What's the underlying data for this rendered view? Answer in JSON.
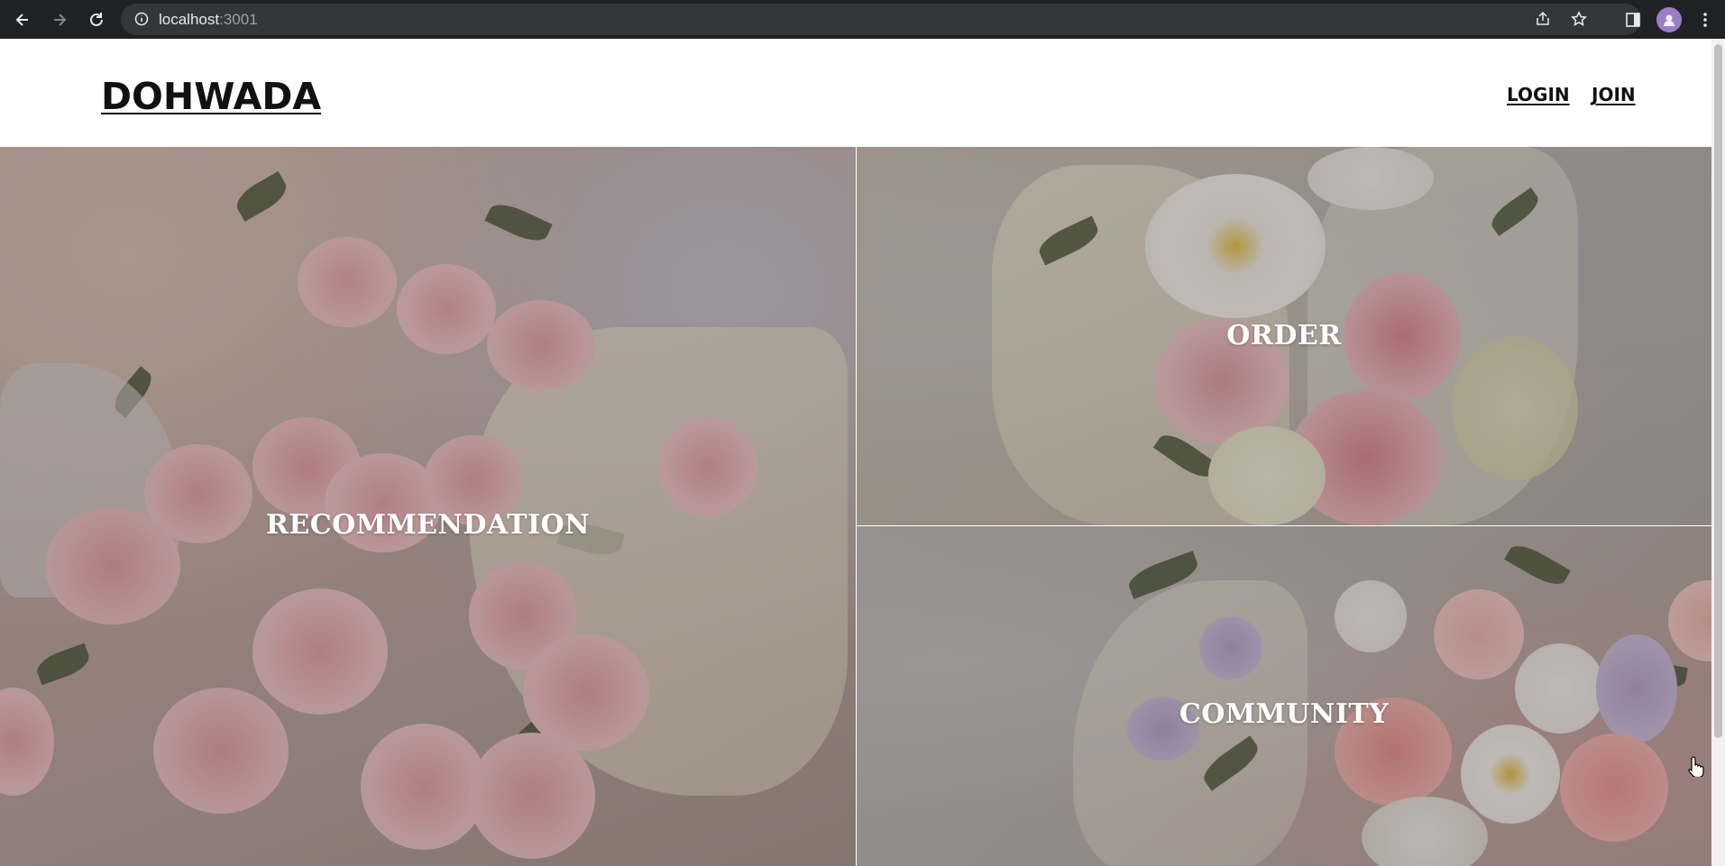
{
  "browser": {
    "url_host": "localhost",
    "url_port": ":3001",
    "icons": [
      "back-icon",
      "forward-icon",
      "reload-icon",
      "info-icon",
      "share-icon",
      "star-icon",
      "sidebar-icon",
      "profile-avatar",
      "menu-icon"
    ]
  },
  "header": {
    "logo": "DOHWADA",
    "login_label": "LOGIN",
    "join_label": "JOIN"
  },
  "panels": {
    "recommendation": "RECOMMENDATION",
    "order": "ORDER",
    "community": "COMMUNITY"
  },
  "colors": {
    "overlay": "#281e1e",
    "header_bg": "#ffffff",
    "chrome_bg": "#202124"
  }
}
